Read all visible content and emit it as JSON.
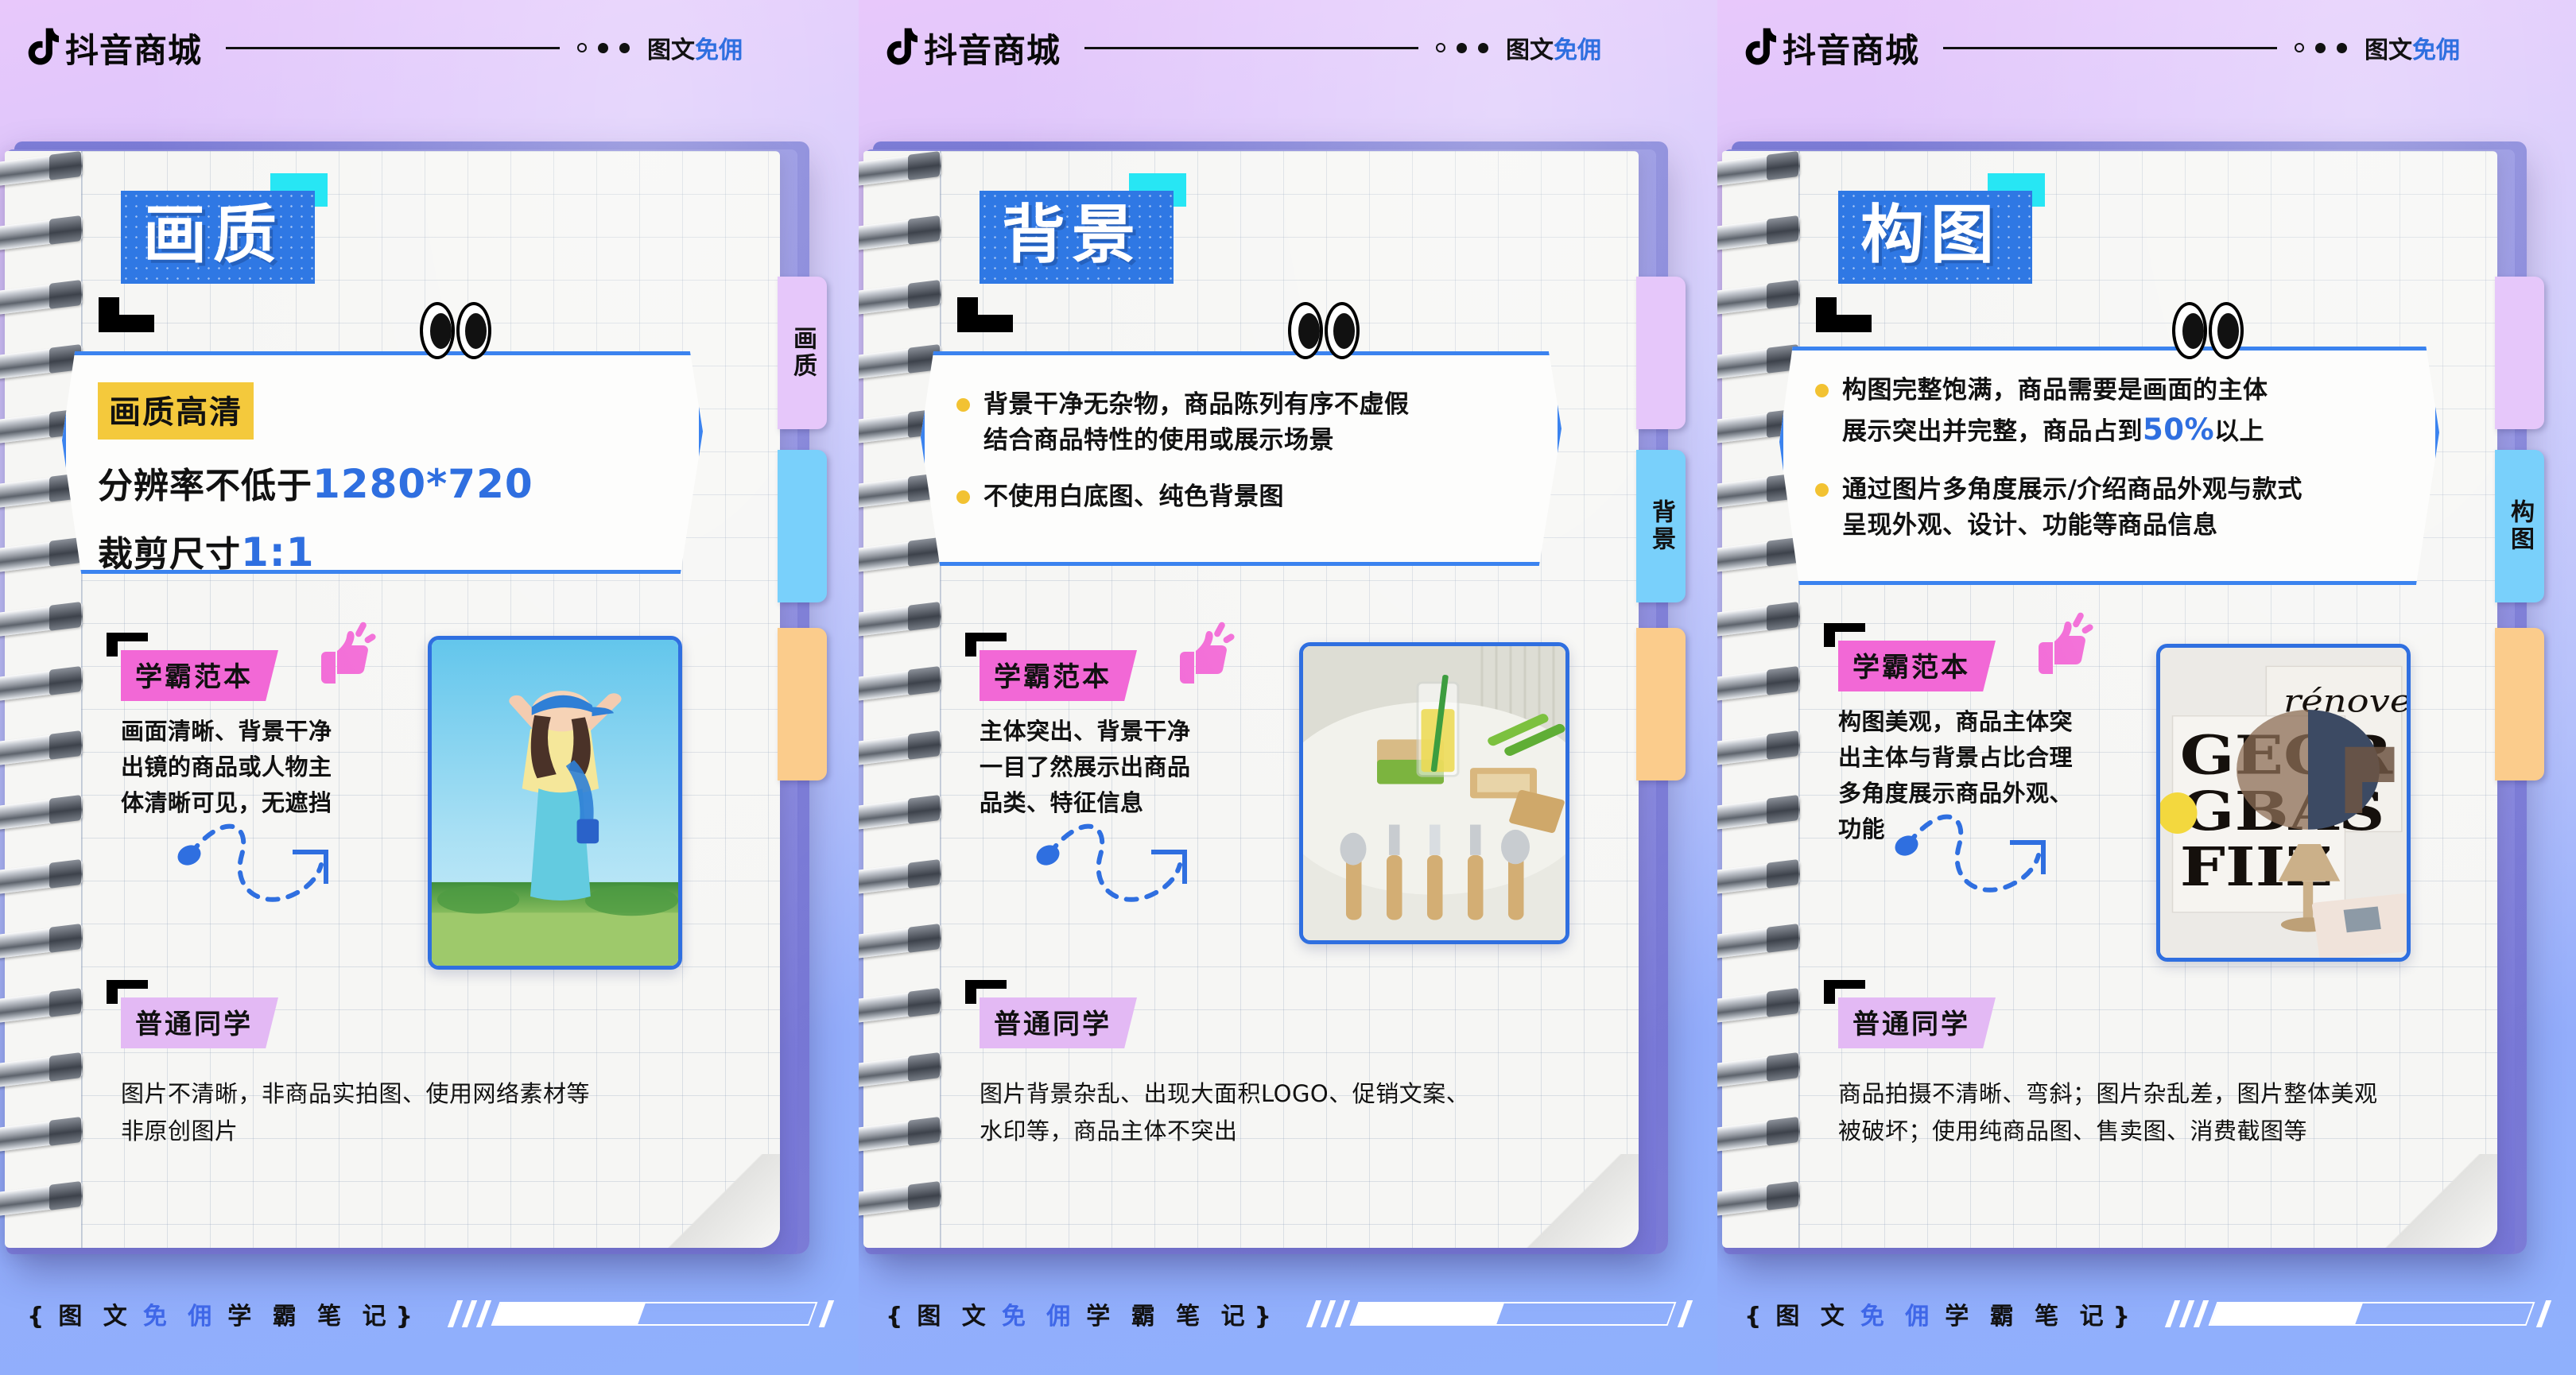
{
  "header": {
    "brand": "抖音商城",
    "logo_icon": "tiktok-note-icon",
    "dots": [
      "hollow",
      "solid",
      "solid"
    ],
    "tag_prefix": "图文",
    "tag_accent": "免佣"
  },
  "footer": {
    "brace_open": "{",
    "part1": "图 文",
    "part2": "免 佣",
    "part3": "学 霸 笔 记",
    "brace_close": "}",
    "progress_percent": 46
  },
  "colors": {
    "title_blue": "#2f78e4",
    "accent_blue": "#2f6fe0",
    "cyan_chip": "#27e6f4",
    "badge_yellow": "#f4c93c",
    "bullet_yellow": "#f2c232",
    "good_pink": "#f268d6",
    "bad_purple": "#e3b9f4",
    "tab_purple": "#e6c7fa",
    "tab_cyan": "#79d0fb",
    "tab_orange": "#fbcc8c",
    "frame_blue": "#2f6fe0"
  },
  "panels": [
    {
      "id": "panel-quality",
      "title": "画质",
      "tabs": [
        {
          "name": "tab-purple",
          "label": "画质",
          "active": true
        },
        {
          "name": "tab-cyan",
          "label": "",
          "active": false
        },
        {
          "name": "tab-orange",
          "label": "",
          "active": false
        }
      ],
      "callout": {
        "type": "badge",
        "badge": "画质高清",
        "lines": [
          {
            "plain": "分辨率不低于",
            "em": "1280*720"
          },
          {
            "plain": "裁剪尺寸",
            "em": "1:1"
          }
        ]
      },
      "good": {
        "label": "学霸范本",
        "text": "画面清晰、背景干净\n出镜的商品或人物主\n体清晰可见，无遮挡",
        "photo_alt": "woman-in-blue-cap-outdoors-photo"
      },
      "bad": {
        "label": "普通同学",
        "text": "图片不清晰，非商品实拍图、使用网络素材等\n非原创图片"
      }
    },
    {
      "id": "panel-background",
      "title": "背景",
      "tabs": [
        {
          "name": "tab-purple",
          "label": "",
          "active": false
        },
        {
          "name": "tab-cyan",
          "label": "背景",
          "active": true
        },
        {
          "name": "tab-orange",
          "label": "",
          "active": false
        }
      ],
      "callout": {
        "type": "bullets",
        "items": [
          [
            "背景干净无杂物，商品陈列有序不虚假",
            "结合商品特性的使用或展示场景"
          ],
          [
            "不使用白底图、纯色背景图"
          ]
        ]
      },
      "good": {
        "label": "学霸范本",
        "text": "主体突出、背景干净\n一目了然展示出商品\n品类、特征信息",
        "photo_alt": "bamboo-cutlery-and-drink-on-table-photo"
      },
      "bad": {
        "label": "普通同学",
        "text": "图片背景杂乱、出现大面积LOGO、促销文案、\n水印等，商品主体不突出"
      }
    },
    {
      "id": "panel-composition",
      "title": "构图",
      "tabs": [
        {
          "name": "tab-purple",
          "label": "",
          "active": false
        },
        {
          "name": "tab-cyan",
          "label": "构图",
          "active": true
        },
        {
          "name": "tab-orange",
          "label": "",
          "active": false
        }
      ],
      "callout": {
        "type": "bullets",
        "items": [
          [
            "构图完整饱满，商品需要是画面的主体",
            "展示突出并完整，商品占到@50%@以上"
          ],
          [
            "通过图片多角度展示/介绍商品外观与款式",
            "呈现外观、设计、功能等商品信息"
          ]
        ]
      },
      "good": {
        "label": "学霸范本",
        "text": "构图美观，商品主体突\n出主体与背景占比合理\n多角度展示商品外观、\n功能",
        "photo_alt": "renover-magazine-and-goblet-photo"
      },
      "bad": {
        "label": "普通同学",
        "text": "商品拍摄不清晰、弯斜；图片杂乱差，图片整体美观\n被破坏；使用纯商品图、售卖图、消费截图等"
      }
    }
  ]
}
